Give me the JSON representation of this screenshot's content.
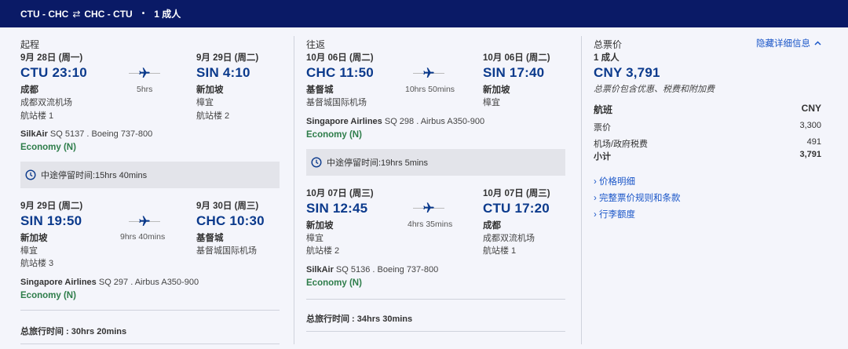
{
  "header": {
    "route_out": "CTU - CHC",
    "swap": "⇄",
    "route_back": "CHC - CTU",
    "dot": "•",
    "passengers": "1 成人"
  },
  "outbound": {
    "label": "起程",
    "seg1": {
      "dep_date": "9月 28日 (周一)",
      "dep_time": "CTU 23:10",
      "dep_city": "成都",
      "dep_airport": "成都双流机场",
      "dep_terminal": "航站楼 1",
      "duration": "5hrs",
      "arr_date": "9月 29日 (周二)",
      "arr_time": "SIN 4:10",
      "arr_city": "新加坡",
      "arr_airport": "樟宜",
      "arr_terminal": "航站楼 2",
      "airline": "SilkAir",
      "flight": "SQ 5137 . Boeing 737-800",
      "cabin": "Economy (N)"
    },
    "layover": "中途停留时间:15hrs 40mins",
    "seg2": {
      "dep_date": "9月 29日 (周二)",
      "dep_time": "SIN 19:50",
      "dep_city": "新加坡",
      "dep_airport": "樟宜",
      "dep_terminal": "航站楼 3",
      "duration": "9hrs 40mins",
      "arr_date": "9月 30日 (周三)",
      "arr_time": "CHC 10:30",
      "arr_city": "基督城",
      "arr_airport": "基督城国际机场",
      "airline": "Singapore Airlines",
      "flight": "SQ 297 . Airbus A350-900",
      "cabin": "Economy (N)"
    },
    "total_label": "总旅行时间 :",
    "total_value": "30hrs 20mins"
  },
  "inbound": {
    "label": "往返",
    "seg1": {
      "dep_date": "10月 06日 (周二)",
      "dep_time": "CHC 11:50",
      "dep_city": "基督城",
      "dep_airport": "基督城国际机场",
      "duration": "10hrs 50mins",
      "arr_date": "10月 06日 (周二)",
      "arr_time": "SIN 17:40",
      "arr_city": "新加坡",
      "arr_airport": "樟宜",
      "airline": "Singapore Airlines",
      "flight": "SQ 298 . Airbus A350-900",
      "cabin": "Economy (N)"
    },
    "layover": "中途停留时间:19hrs 5mins",
    "seg2": {
      "dep_date": "10月 07日 (周三)",
      "dep_time": "SIN 12:45",
      "dep_city": "新加坡",
      "dep_airport": "樟宜",
      "dep_terminal": "航站楼 2",
      "duration": "4hrs 35mins",
      "arr_date": "10月 07日 (周三)",
      "arr_time": "CTU 17:20",
      "arr_city": "成都",
      "arr_airport": "成都双流机场",
      "arr_terminal": "航站楼 1",
      "airline": "SilkAir",
      "flight": "SQ 5136 . Boeing 737-800",
      "cabin": "Economy (N)"
    },
    "total_label": "总旅行时间 :",
    "total_value": "34hrs 30mins"
  },
  "summary": {
    "title": "总票价",
    "hide_details": "隐藏详细信息",
    "passengers": "1 成人",
    "price": "CNY 3,791",
    "note": "总票价包含优惠、税费和附加费",
    "flight_header": "航班",
    "currency_header": "CNY",
    "rows": [
      {
        "label": "票价",
        "value": "3,300"
      },
      {
        "label": "机场/政府税费",
        "value": "491"
      }
    ],
    "subtotal_label": "小计",
    "subtotal_value": "3,791",
    "links": [
      "价格明细",
      "完整票价规则和条款",
      "行李额度"
    ]
  },
  "colors": {
    "header_bg": "#0a1a66",
    "time": "#0b3a8c",
    "cabin": "#2e7d4a",
    "link": "#1a56c8"
  }
}
